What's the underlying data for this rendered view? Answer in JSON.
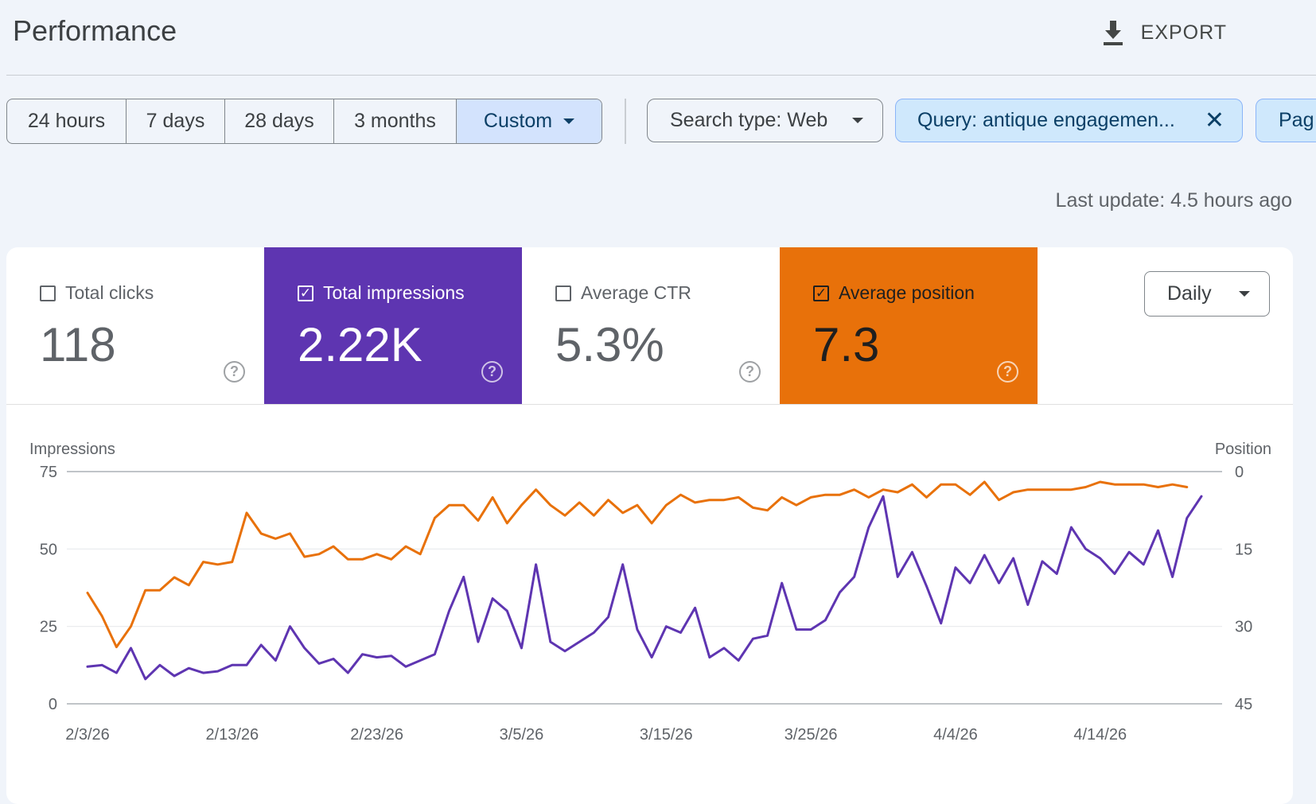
{
  "header": {
    "title": "Performance",
    "export_label": "EXPORT"
  },
  "date_range": {
    "options": [
      "24 hours",
      "7 days",
      "28 days",
      "3 months",
      "Custom"
    ],
    "selected": "Custom"
  },
  "filters": {
    "search_type": "Search type: Web",
    "query": "Query: antique engagemen...",
    "page_partial": "Pag"
  },
  "last_update": "Last update: 4.5 hours ago",
  "metrics": {
    "clicks": {
      "label": "Total clicks",
      "value": "118",
      "checked": false
    },
    "impressions": {
      "label": "Total impressions",
      "value": "2.22K",
      "checked": true
    },
    "ctr": {
      "label": "Average CTR",
      "value": "5.3%",
      "checked": false
    },
    "position": {
      "label": "Average position",
      "value": "7.3",
      "checked": true
    }
  },
  "granularity": "Daily",
  "colors": {
    "impressions": "#5e35b1",
    "position": "#e8710a",
    "query_chip": "#cfe8fc"
  },
  "chart_data": {
    "type": "line",
    "ylabel_left": "Impressions",
    "ylabel_right": "Position",
    "y_left_ticks": [
      "75",
      "50",
      "25",
      "0"
    ],
    "y_right_ticks": [
      "0",
      "15",
      "30",
      "45"
    ],
    "ylim_left": [
      0,
      75
    ],
    "ylim_right_inverted": [
      0,
      45
    ],
    "x_tick_labels": [
      "2/3/26",
      "2/13/26",
      "2/23/26",
      "3/5/26",
      "3/15/26",
      "3/25/26",
      "4/4/26",
      "4/14/26"
    ],
    "x_start": "2/3/26",
    "x_end": "4/21/26",
    "grid": true,
    "series": [
      {
        "name": "Impressions",
        "axis": "left",
        "values": [
          12,
          12.5,
          10,
          18,
          8,
          12.5,
          9,
          11.5,
          10,
          10.5,
          12.5,
          12.5,
          19,
          14,
          25,
          18,
          13,
          14.5,
          10,
          16,
          15,
          15.5,
          12,
          14,
          16,
          30,
          41,
          20,
          34,
          30,
          18,
          45,
          20,
          17,
          20,
          23,
          28,
          45,
          24,
          15,
          25,
          23,
          31,
          15,
          18,
          14,
          21,
          22,
          39,
          24,
          24,
          27,
          36,
          41,
          57,
          67,
          41,
          49,
          38,
          26,
          44,
          39,
          48,
          39,
          47,
          32,
          46,
          42,
          57,
          50,
          47,
          42,
          49,
          45,
          56,
          41,
          60,
          67
        ]
      },
      {
        "name": "Average position",
        "axis": "right",
        "values": [
          23.5,
          28,
          34,
          30,
          23,
          23,
          20.5,
          22,
          17.5,
          18,
          17.5,
          8,
          12,
          13,
          12,
          16.5,
          16,
          14.5,
          17,
          17,
          16,
          17,
          14.5,
          16,
          9,
          6.5,
          6.5,
          9.5,
          5,
          10,
          6.5,
          3.5,
          6.5,
          8.5,
          6,
          8.5,
          5.5,
          8,
          6.5,
          10,
          6.5,
          4.5,
          6,
          5.5,
          5.5,
          5,
          7,
          7.5,
          5,
          6.5,
          5,
          4.5,
          4.5,
          3.5,
          5,
          3.5,
          4,
          2.5,
          5,
          2.5,
          2.5,
          4.5,
          2,
          5.5,
          4,
          3.5,
          3.5,
          3.5,
          3.5,
          3,
          2,
          2.5,
          2.5,
          2.5,
          3,
          2.5,
          3
        ]
      }
    ]
  }
}
